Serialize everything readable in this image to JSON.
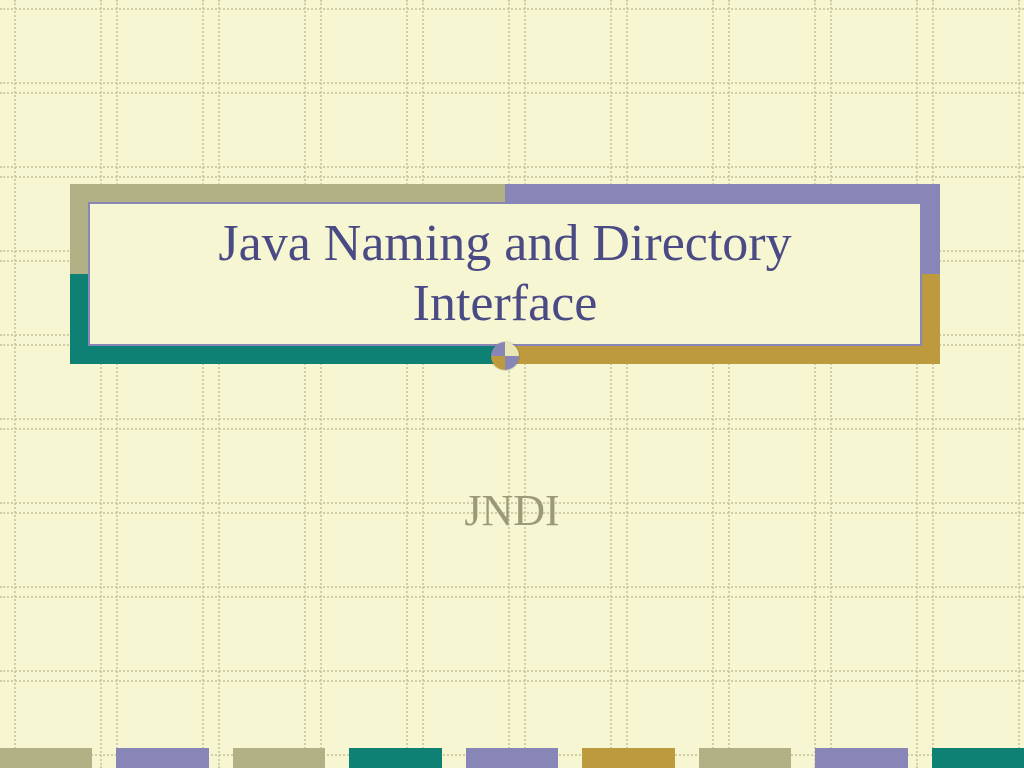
{
  "slide": {
    "title": "Java Naming and Directory Interface",
    "subtitle": "JNDI"
  },
  "palette": {
    "olive": "#b2b085",
    "purple": "#8886b7",
    "teal": "#0f8074",
    "ochre": "#bd9a3e"
  },
  "footer_swatches": [
    "olive",
    "purple",
    "olive",
    "teal",
    "purple",
    "ochre",
    "olive",
    "purple",
    "teal"
  ]
}
